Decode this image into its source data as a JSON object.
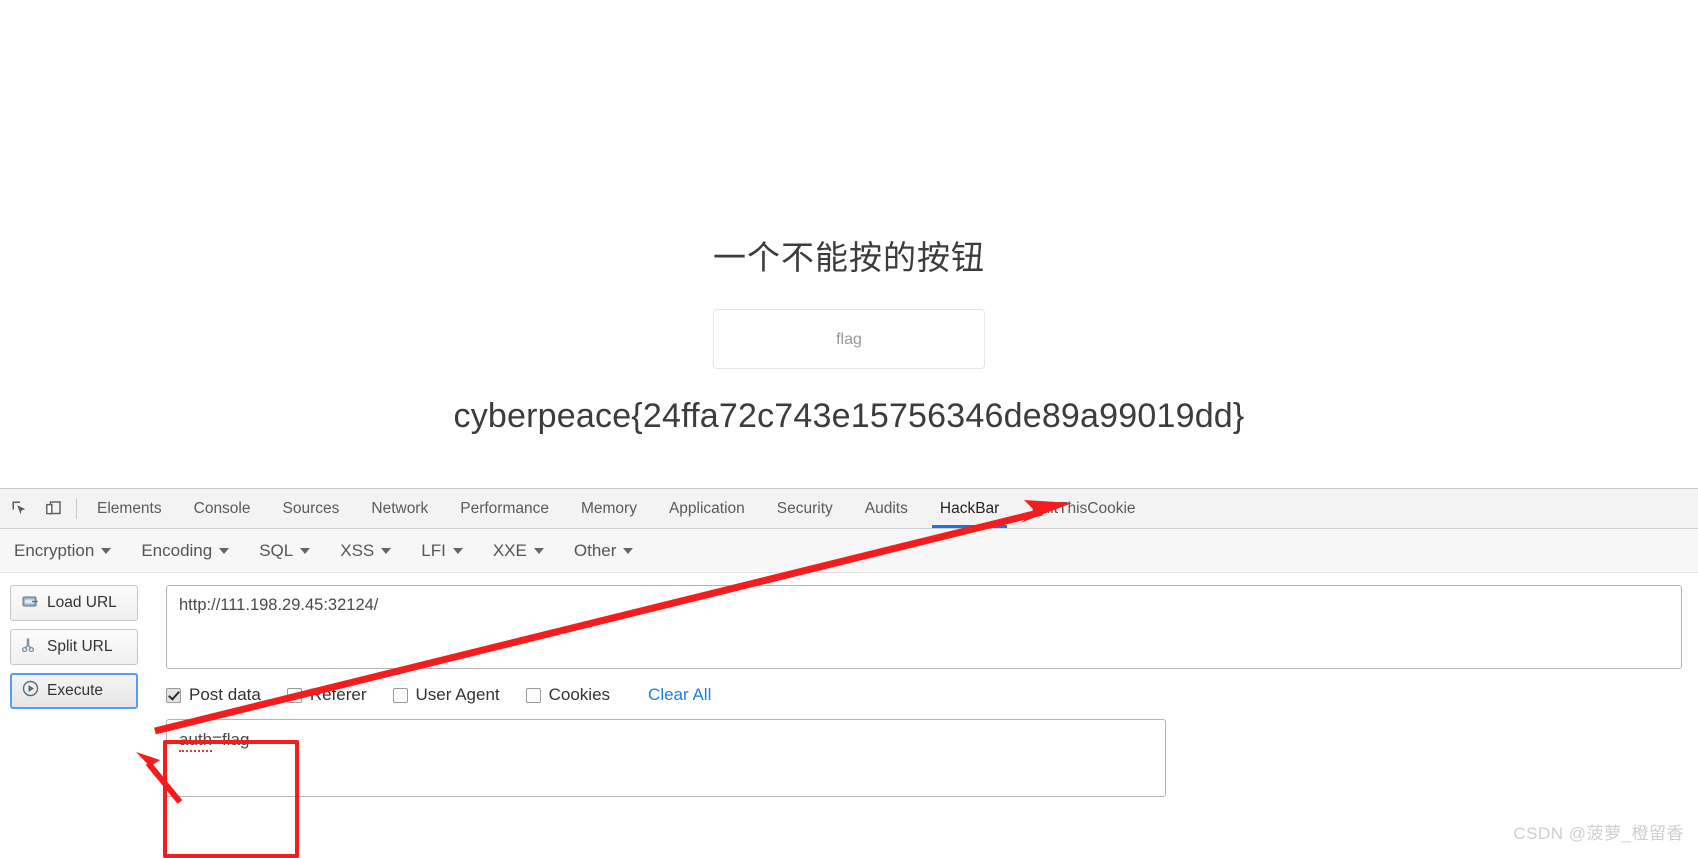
{
  "page": {
    "heading": "一个不能按的按钮",
    "flag_button_label": "flag",
    "flag_result": "cyberpeace{24ffa72c743e15756346de89a99019dd}"
  },
  "devtools": {
    "icons": [
      {
        "name": "inspect-element-icon",
        "label": "Inspect element"
      },
      {
        "name": "device-toolbar-icon",
        "label": "Toggle device toolbar"
      }
    ],
    "tabs": [
      {
        "label": "Elements",
        "active": false
      },
      {
        "label": "Console",
        "active": false
      },
      {
        "label": "Sources",
        "active": false
      },
      {
        "label": "Network",
        "active": false
      },
      {
        "label": "Performance",
        "active": false
      },
      {
        "label": "Memory",
        "active": false
      },
      {
        "label": "Application",
        "active": false
      },
      {
        "label": "Security",
        "active": false
      },
      {
        "label": "Audits",
        "active": false
      },
      {
        "label": "HackBar",
        "active": true
      },
      {
        "label": "EditThisCookie",
        "active": false
      }
    ]
  },
  "hackbar": {
    "menus": [
      {
        "label": "Encryption"
      },
      {
        "label": "Encoding"
      },
      {
        "label": "SQL"
      },
      {
        "label": "XSS"
      },
      {
        "label": "LFI"
      },
      {
        "label": "XXE"
      },
      {
        "label": "Other"
      }
    ],
    "buttons": [
      {
        "label": "Load URL",
        "icon": "load-url-icon"
      },
      {
        "label": "Split URL",
        "icon": "split-url-icon"
      },
      {
        "label": "Execute",
        "icon": "execute-icon"
      }
    ],
    "url_value": "http://111.198.29.45:32124/",
    "options": [
      {
        "label": "Post data",
        "checked": true
      },
      {
        "label": "Referer",
        "checked": false
      },
      {
        "label": "User Agent",
        "checked": false
      },
      {
        "label": "Cookies",
        "checked": false
      }
    ],
    "clear_all_label": "Clear All",
    "post_data_value": "auth=flag",
    "post_data_spellcheck_word": "auth",
    "post_data_rest": "=flag"
  },
  "annotations": {
    "arrow_color": "#f41c1c",
    "highlight_color": "#f41c1c"
  },
  "watermark": "CSDN @菠萝_橙留香"
}
